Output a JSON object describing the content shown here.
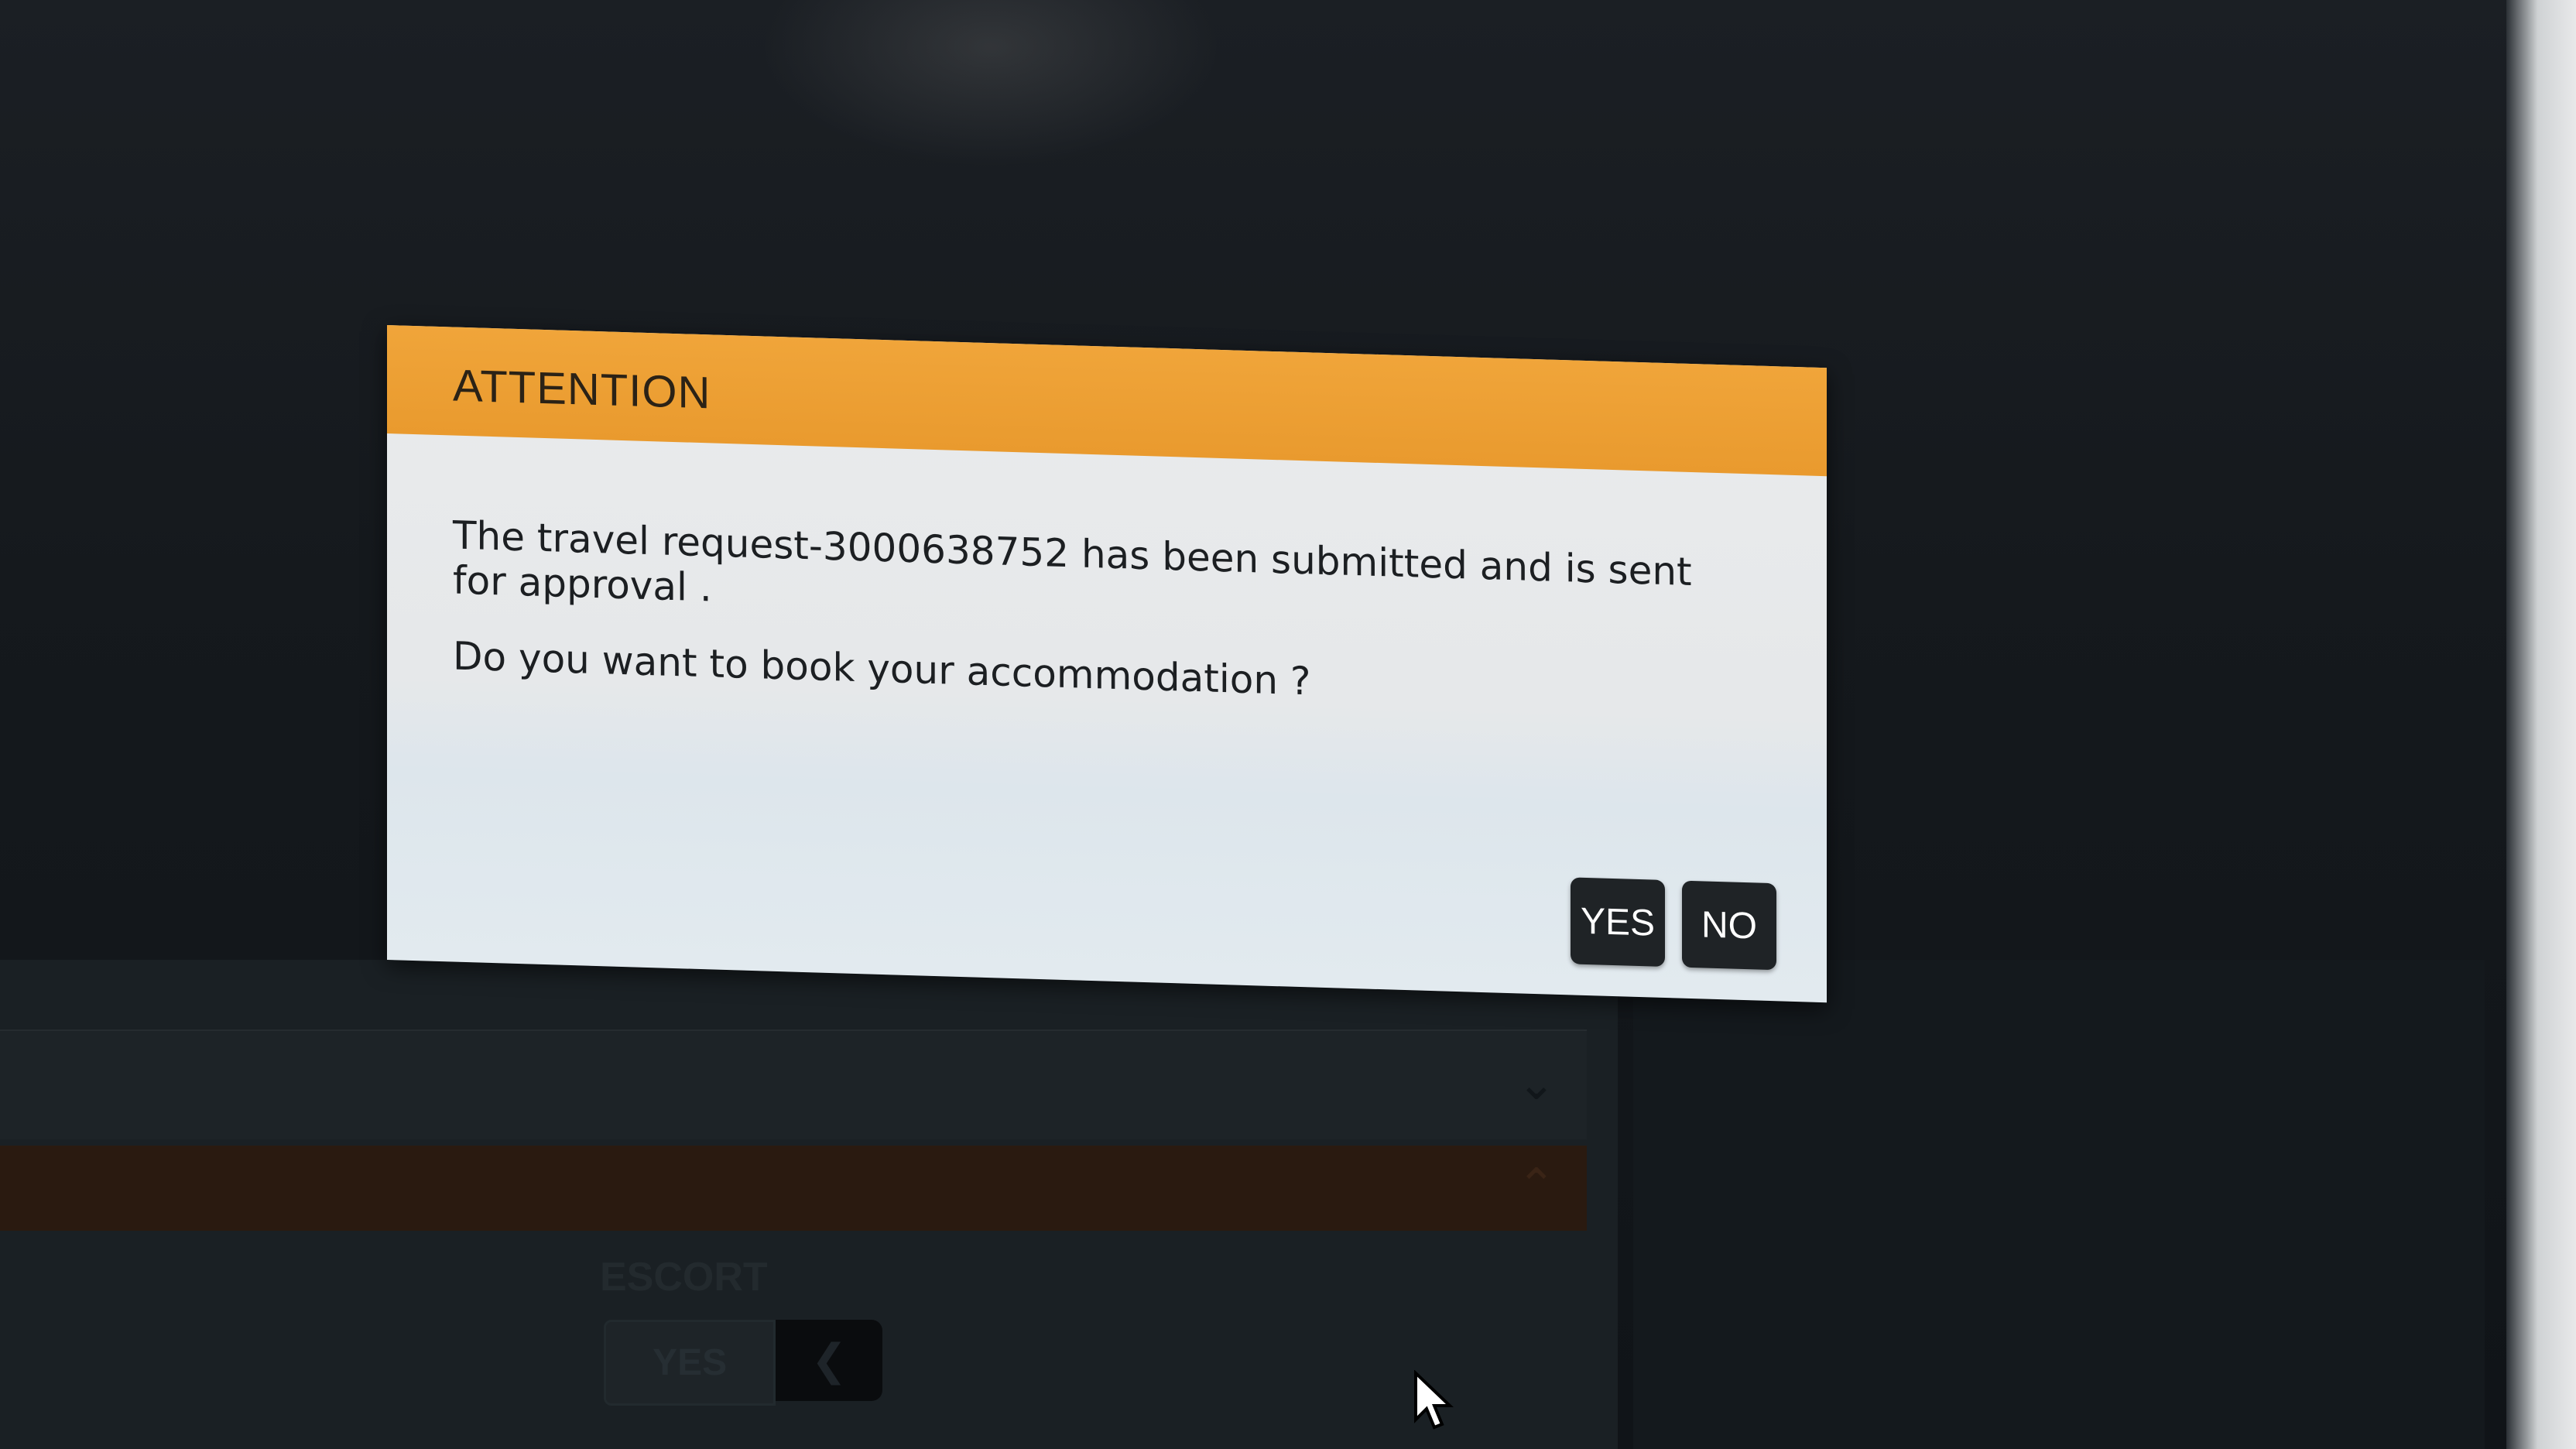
{
  "dialog": {
    "title": "ATTENTION",
    "message": "The travel request-3000638752 has been submitted and is sent for approval .",
    "question": "Do you want to book your accommodation ?",
    "yes_label": "YES",
    "no_label": "NO",
    "header_color": "#f0a53a"
  },
  "background": {
    "escort_label": "ESCORT",
    "escort_value": "YES",
    "back_icon": "chevron-left-icon",
    "collapsed_icon": "chevron-down-icon",
    "expanded_icon": "chevron-up-icon"
  }
}
